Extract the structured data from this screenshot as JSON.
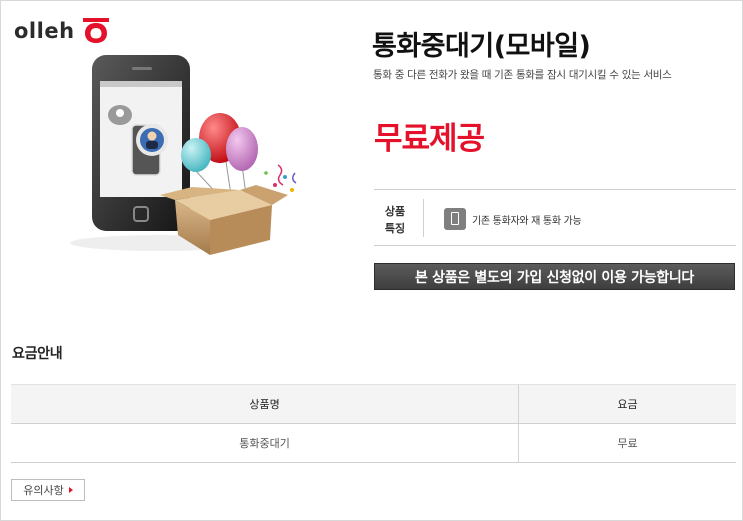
{
  "brand": {
    "logo_text": "olleh",
    "accent": "#e5112a"
  },
  "product": {
    "title": "통화중대기(모바일)",
    "subtitle": "통화 중 다른 전화가 왔을 때 기존 통화를 잠시 대기시킬 수 있는 서비스",
    "price_label": "무료제공",
    "feature": {
      "label_line1": "상품",
      "label_line2": "특징",
      "text": "기존 통화자와 재 통화 가능",
      "icon": "mobile-phone-icon"
    },
    "notice": "본 상품은 별도의 가입 신청없이 이용 가능합니다"
  },
  "fee_guide": {
    "title": "요금안내",
    "columns": [
      "상품명",
      "요금"
    ],
    "rows": [
      [
        "통화중대기",
        "무료"
      ]
    ]
  },
  "caution_button": {
    "label": "유의사항"
  },
  "colors": {
    "price_red": "#e5112a",
    "notice_bar": "#4a4a4a"
  }
}
